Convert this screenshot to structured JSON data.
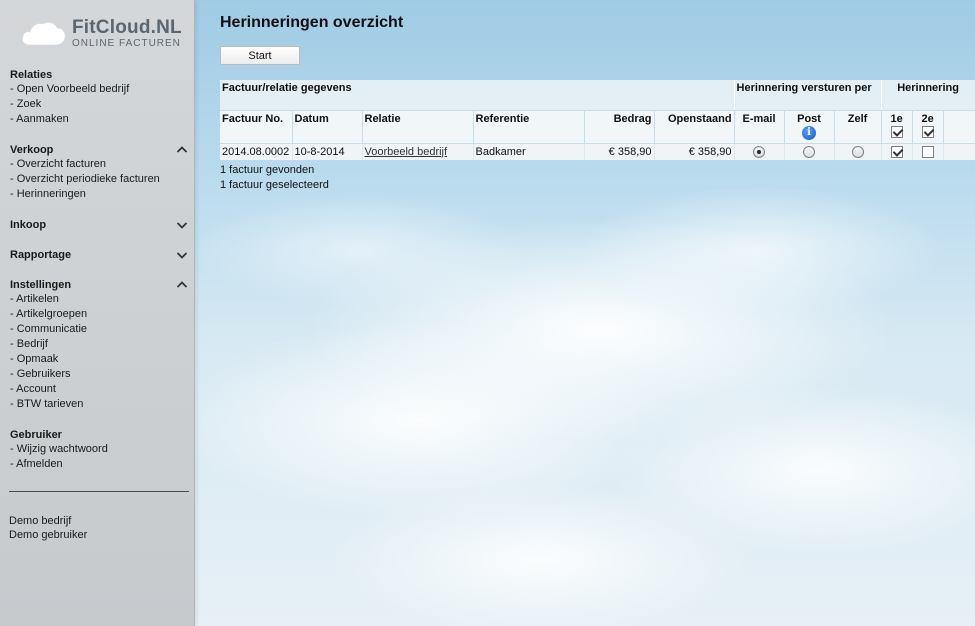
{
  "logo": {
    "name": "FitCloud.NL",
    "subtitle": "ONLINE FACTUREN"
  },
  "sidebar": {
    "groups": [
      {
        "title": "Relaties",
        "expandable": false,
        "items": [
          "Open Voorbeeld bedrijf",
          "Zoek",
          "Aanmaken"
        ]
      },
      {
        "title": "Verkoop",
        "expandable": true,
        "expanded": true,
        "items": [
          "Overzicht facturen",
          "Overzicht periodieke facturen",
          "Herinneringen"
        ]
      },
      {
        "title": "Inkoop",
        "expandable": true,
        "expanded": false,
        "items": []
      },
      {
        "title": "Rapportage",
        "expandable": true,
        "expanded": false,
        "items": []
      },
      {
        "title": "Instellingen",
        "expandable": true,
        "expanded": true,
        "items": [
          "Artikelen",
          "Artikelgroepen",
          "Communicatie",
          "Bedrijf",
          "Opmaak",
          "Gebruikers",
          "Account",
          "BTW tarieven"
        ]
      },
      {
        "title": "Gebruiker",
        "expandable": false,
        "items": [
          "Wijzig wachtwoord",
          "Afmelden"
        ]
      }
    ],
    "company": "Demo bedrijf",
    "user": "Demo gebruiker"
  },
  "page": {
    "title": "Herinneringen overzicht",
    "start_label": "Start"
  },
  "table": {
    "groups": {
      "invoice": "Factuur/relatie gegevens",
      "send": "Herinnering versturen per",
      "reminder": "Herinnering"
    },
    "columns": {
      "invoice_no": "Factuur No.",
      "date": "Datum",
      "relation": "Relatie",
      "reference": "Referentie",
      "amount": "Bedrag",
      "outstanding": "Openstaand",
      "email": "E-mail",
      "post": "Post",
      "self": "Zelf",
      "first": "1e",
      "second": "2e"
    },
    "header_checks": {
      "first": true,
      "second": true
    },
    "rows": [
      {
        "invoice_no": "2014.08.0002",
        "date": "10-8-2014",
        "relation": "Voorbeeld bedrijf",
        "reference": "Badkamer",
        "amount": "€ 358,90",
        "outstanding": "€ 358,90",
        "send_via": "email",
        "first": true,
        "second": false
      }
    ]
  },
  "summary": {
    "found": "1 factuur gevonden",
    "selected": "1 factuur geselecteerd"
  },
  "colors": {
    "accent": "#1458c8",
    "sidebar": "#c9cdd0"
  }
}
